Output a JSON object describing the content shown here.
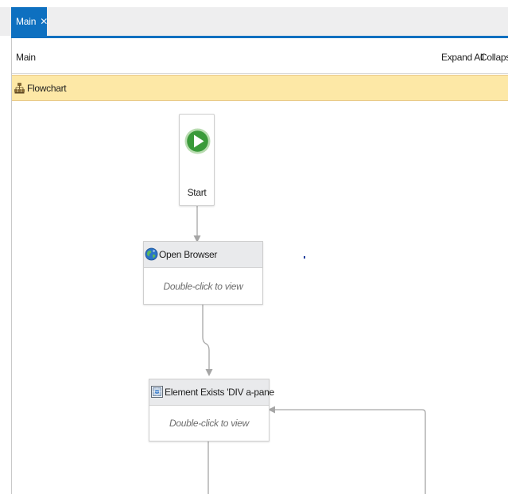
{
  "tabs": [
    {
      "label": "Main",
      "close_glyph": "✕",
      "active": true
    }
  ],
  "breadcrumb": {
    "text": "Main"
  },
  "toolbar": {
    "expand_all_label": "Expand All",
    "collapse_label": "Collapse"
  },
  "flowchart": {
    "title": "Flowchart",
    "icon": "flowchart-icon"
  },
  "nodes": {
    "start": {
      "label": "Start",
      "icon": "play-icon"
    },
    "open_browser": {
      "title": "Open Browser",
      "hint": "Double-click to view",
      "icon": "globe-icon"
    },
    "element_exists": {
      "title": "Element Exists 'DIV  a-pane",
      "hint": "Double-click to view",
      "icon": "element-exists-icon"
    }
  },
  "colors": {
    "tab_active": "#0e70c0",
    "flowchart_header": "#fde8a6",
    "start_green": "#3a9a3a",
    "connector": "#a6a6a6"
  }
}
